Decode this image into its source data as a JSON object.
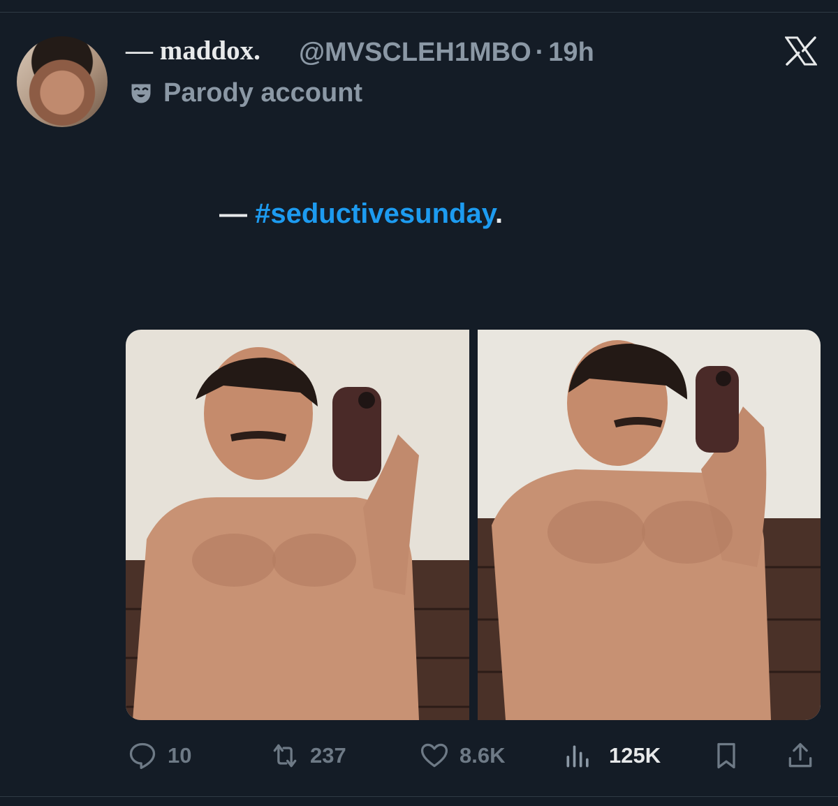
{
  "author": {
    "display_name": "— maddox.",
    "handle": "@MVSCLEH1MBO",
    "separator": "·",
    "time": "19h",
    "label": "Parody account",
    "label_icon": "theater-mask-icon",
    "avatar_icon": "profile-avatar"
  },
  "platform_icon": "x-logo-icon",
  "tweet": {
    "prefix": "— ",
    "hashtag": "#seductivesunday",
    "suffix": "."
  },
  "media": {
    "count": 2,
    "images": [
      "selfie-photo-1",
      "selfie-photo-2"
    ]
  },
  "actions": {
    "replies": "10",
    "reposts": "237",
    "likes": "8.6K",
    "views": "125K",
    "bookmark_icon": "bookmark-icon",
    "share_icon": "share-icon"
  },
  "colors": {
    "background": "#141c26",
    "text": "#e7e9ea",
    "muted": "#8b98a5",
    "hashtag": "#1d9bf0"
  }
}
